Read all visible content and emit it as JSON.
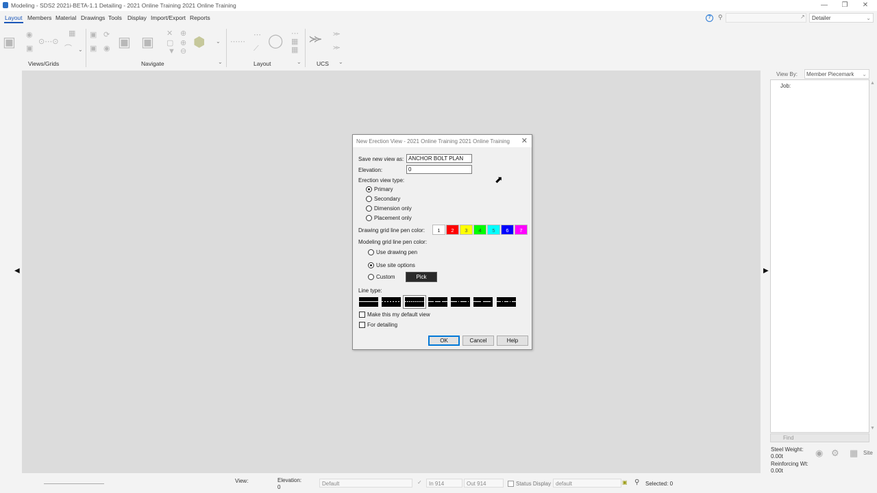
{
  "window": {
    "title": "Modeling - SDS2 2021i-BETA-1.1 Detailing - 2021 Online Training 2021 Online Training",
    "minimize": "—",
    "restore": "❐",
    "close": "✕"
  },
  "menu": [
    "Layout",
    "Members",
    "Material",
    "Drawings",
    "Tools",
    "Display",
    "Import/Export",
    "Reports"
  ],
  "toolbar_right": {
    "help": "?",
    "search_placeholder": "",
    "role": "Detailer"
  },
  "ribbon": {
    "groups": [
      "Views/Grids",
      "Navigate",
      "Layout",
      "UCS"
    ]
  },
  "right_panel": {
    "view_by_label": "View By:",
    "view_by_value": "Member Piecemark",
    "tree_root": "Job:",
    "find": "Find",
    "steel_weight_label": "Steel Weight:",
    "steel_weight_value": "0.00t",
    "reinforcing_label": "Reinforcing Wt:",
    "reinforcing_value": "0.00t",
    "site_label": "Site"
  },
  "status_bar": {
    "view_label": "View:",
    "elevation_label": "Elevation:",
    "elevation_value": "0",
    "layer_value": "Default",
    "in_value": "In 914",
    "out_value": "Out 914",
    "status_display_label": "Status Display",
    "status_display_value": "default",
    "selected": "Selected: 0"
  },
  "dialog": {
    "title": "New Erection View - 2021 Online Training 2021 Online Training",
    "save_label": "Save new view as:",
    "save_value": "ANCHOR BOLT PLAN",
    "elevation_label": "Elevation:",
    "elevation_value": "0",
    "view_type_label": "Erection view type:",
    "view_types": [
      "Primary",
      "Secondary",
      "Dimension only",
      "Placement only"
    ],
    "view_type_selected": "Primary",
    "grid_pen_label": "Drawing grid line pen color:",
    "pen_colors": [
      {
        "label": "1",
        "bg": "#ffffff",
        "fg": "#222222"
      },
      {
        "label": "2",
        "bg": "#ff0000",
        "fg": "#ffffff"
      },
      {
        "label": "3",
        "bg": "#ffff00",
        "fg": "#555555"
      },
      {
        "label": "4",
        "bg": "#00ff00",
        "fg": "#333333"
      },
      {
        "label": "5",
        "bg": "#00ffff",
        "fg": "#555555"
      },
      {
        "label": "6",
        "bg": "#0000ff",
        "fg": "#ffffff"
      },
      {
        "label": "7",
        "bg": "#ff00ff",
        "fg": "#ffffff"
      }
    ],
    "model_pen_label": "Modeling grid line pen color:",
    "model_pen_options": [
      "Use drawing pen",
      "Use site options",
      "Custom"
    ],
    "model_pen_selected": "Use site options",
    "pick": "Pick",
    "line_type_label": "Line type:",
    "default_view_label": "Make this my default view",
    "for_detailing_label": "For detailing",
    "ok": "OK",
    "cancel": "Cancel",
    "help": "Help"
  }
}
